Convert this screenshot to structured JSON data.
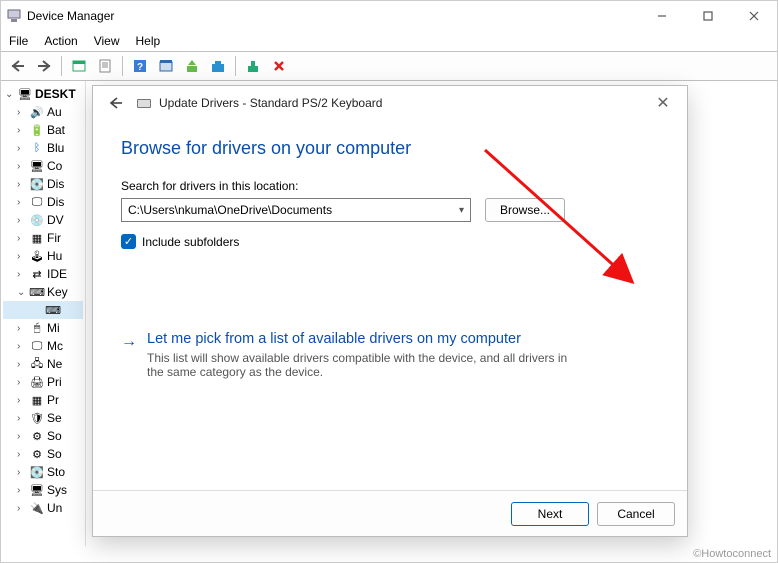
{
  "window": {
    "title": "Device Manager"
  },
  "menu": {
    "items": [
      "File",
      "Action",
      "View",
      "Help"
    ]
  },
  "tree": {
    "root": "DESKT",
    "nodes": [
      {
        "label": "Au",
        "icon": "🔊",
        "exp": ">"
      },
      {
        "label": "Bat",
        "icon": "🔋",
        "exp": ">"
      },
      {
        "label": "Blu",
        "icon": "ᛒ",
        "exp": ">",
        "color": "#1a6fd6"
      },
      {
        "label": "Co",
        "icon": "🖥",
        "exp": ">"
      },
      {
        "label": "Dis",
        "icon": "💽",
        "exp": ">"
      },
      {
        "label": "Dis",
        "icon": "🖵",
        "exp": ">"
      },
      {
        "label": "DV",
        "icon": "💿",
        "exp": ">"
      },
      {
        "label": "Fir",
        "icon": "▦",
        "exp": ">"
      },
      {
        "label": "Hu",
        "icon": "🕹",
        "exp": ">"
      },
      {
        "label": "IDE",
        "icon": "⇄",
        "exp": ">"
      },
      {
        "label": "Key",
        "icon": "⌨",
        "exp": "v",
        "children": [
          {
            "label": "",
            "icon": "⌨"
          }
        ]
      },
      {
        "label": "Mi",
        "icon": "🖱",
        "exp": ">"
      },
      {
        "label": "Mc",
        "icon": "🖵",
        "exp": ">"
      },
      {
        "label": "Ne",
        "icon": "🖧",
        "exp": ">"
      },
      {
        "label": "Pri",
        "icon": "🖨",
        "exp": ">"
      },
      {
        "label": "Pr",
        "icon": "▦",
        "exp": ">"
      },
      {
        "label": "Se",
        "icon": "🛡",
        "exp": ">"
      },
      {
        "label": "So",
        "icon": "⚙",
        "exp": ">"
      },
      {
        "label": "So",
        "icon": "⚙",
        "exp": ">"
      },
      {
        "label": "Sto",
        "icon": "💽",
        "exp": ">"
      },
      {
        "label": "Sys",
        "icon": "🖥",
        "exp": ">"
      },
      {
        "label": "Un",
        "icon": "🔌",
        "exp": ">"
      }
    ]
  },
  "dialog": {
    "title": "Update Drivers - Standard PS/2 Keyboard",
    "heading": "Browse for drivers on your computer",
    "search_label": "Search for drivers in this location:",
    "path_value": "C:\\Users\\nkuma\\OneDrive\\Documents",
    "browse_label": "Browse...",
    "include_subfolders_label": "Include subfolders",
    "alt_main": "Let me pick from a list of available drivers on my computer",
    "alt_desc": "This list will show available drivers compatible with the device, and all drivers in the same category as the device.",
    "next_label": "Next",
    "cancel_label": "Cancel"
  },
  "watermark": "©Howtoconnect"
}
